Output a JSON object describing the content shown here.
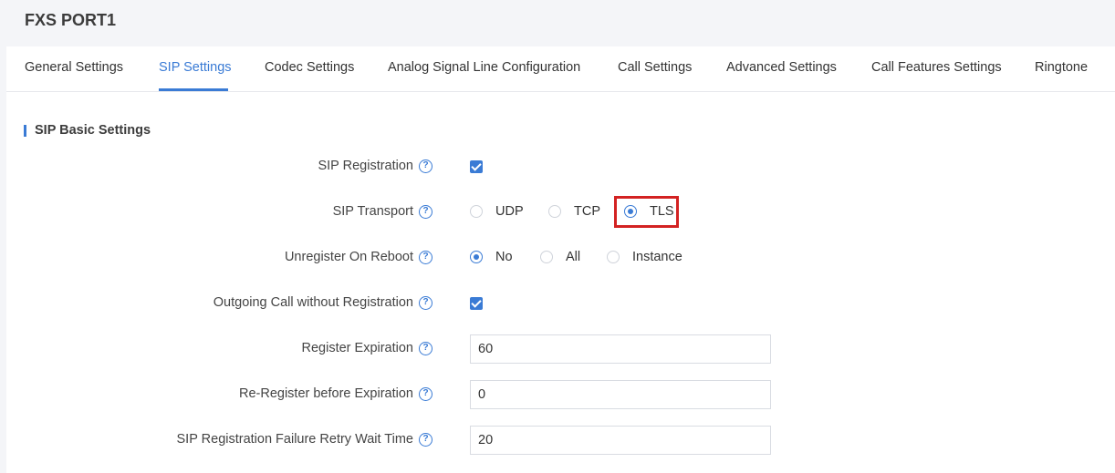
{
  "header": {
    "title": "FXS PORT1"
  },
  "tabs": [
    {
      "label": "General Settings"
    },
    {
      "label": "SIP Settings",
      "active": true
    },
    {
      "label": "Codec Settings"
    },
    {
      "label": "Analog Signal Line Configuration"
    },
    {
      "label": "Call Settings"
    },
    {
      "label": "Advanced Settings"
    },
    {
      "label": "Call Features Settings"
    },
    {
      "label": "Ringtone"
    }
  ],
  "section": {
    "title": "SIP Basic Settings"
  },
  "fields": {
    "sip_registration": {
      "label": "SIP Registration",
      "checked": true
    },
    "sip_transport": {
      "label": "SIP Transport",
      "options": [
        "UDP",
        "TCP",
        "TLS"
      ],
      "selected": "TLS"
    },
    "unregister_on_reboot": {
      "label": "Unregister On Reboot",
      "options": [
        "No",
        "All",
        "Instance"
      ],
      "selected": "No"
    },
    "outgoing_call_without_registration": {
      "label": "Outgoing Call without Registration",
      "checked": true
    },
    "register_expiration": {
      "label": "Register Expiration",
      "value": "60"
    },
    "re_register_before_expiration": {
      "label": "Re-Register before Expiration",
      "value": "0"
    },
    "sip_registration_failure_retry_wait_time": {
      "label": "SIP Registration Failure Retry Wait Time",
      "value": "20"
    }
  },
  "help_icon_glyph": "?",
  "colors": {
    "accent": "#3a7bd5",
    "highlight": "#d32222",
    "background": "#f4f5f8"
  }
}
